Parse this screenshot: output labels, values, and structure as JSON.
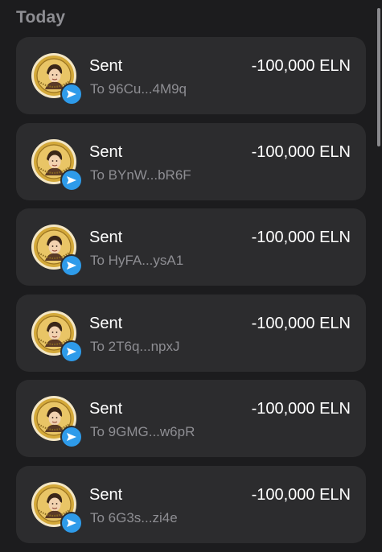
{
  "section": {
    "title": "Today"
  },
  "transactions": [
    {
      "title": "Sent",
      "recipient": "To 96Cu...4M9q",
      "amount": "-100,000 ELN",
      "avatar_icon": "eln-token-icon",
      "badge_icon": "send-arrow-icon"
    },
    {
      "title": "Sent",
      "recipient": "To BYnW...bR6F",
      "amount": "-100,000 ELN",
      "avatar_icon": "eln-token-icon",
      "badge_icon": "send-arrow-icon"
    },
    {
      "title": "Sent",
      "recipient": "To HyFA...ysA1",
      "amount": "-100,000 ELN",
      "avatar_icon": "eln-token-icon",
      "badge_icon": "send-arrow-icon"
    },
    {
      "title": "Sent",
      "recipient": "To 2T6q...npxJ",
      "amount": "-100,000 ELN",
      "avatar_icon": "eln-token-icon",
      "badge_icon": "send-arrow-icon"
    },
    {
      "title": "Sent",
      "recipient": "To 9GMG...w6pR",
      "amount": "-100,000 ELN",
      "avatar_icon": "eln-token-icon",
      "badge_icon": "send-arrow-icon"
    },
    {
      "title": "Sent",
      "recipient": "To 6G3s...zi4e",
      "amount": "-100,000 ELN",
      "avatar_icon": "eln-token-icon",
      "badge_icon": "send-arrow-icon"
    }
  ],
  "colors": {
    "background": "#1c1c1e",
    "card": "#2c2c2e",
    "secondary_text": "#8e8e93",
    "badge": "#2e9bea",
    "coin_gold": "#d4a93a"
  }
}
